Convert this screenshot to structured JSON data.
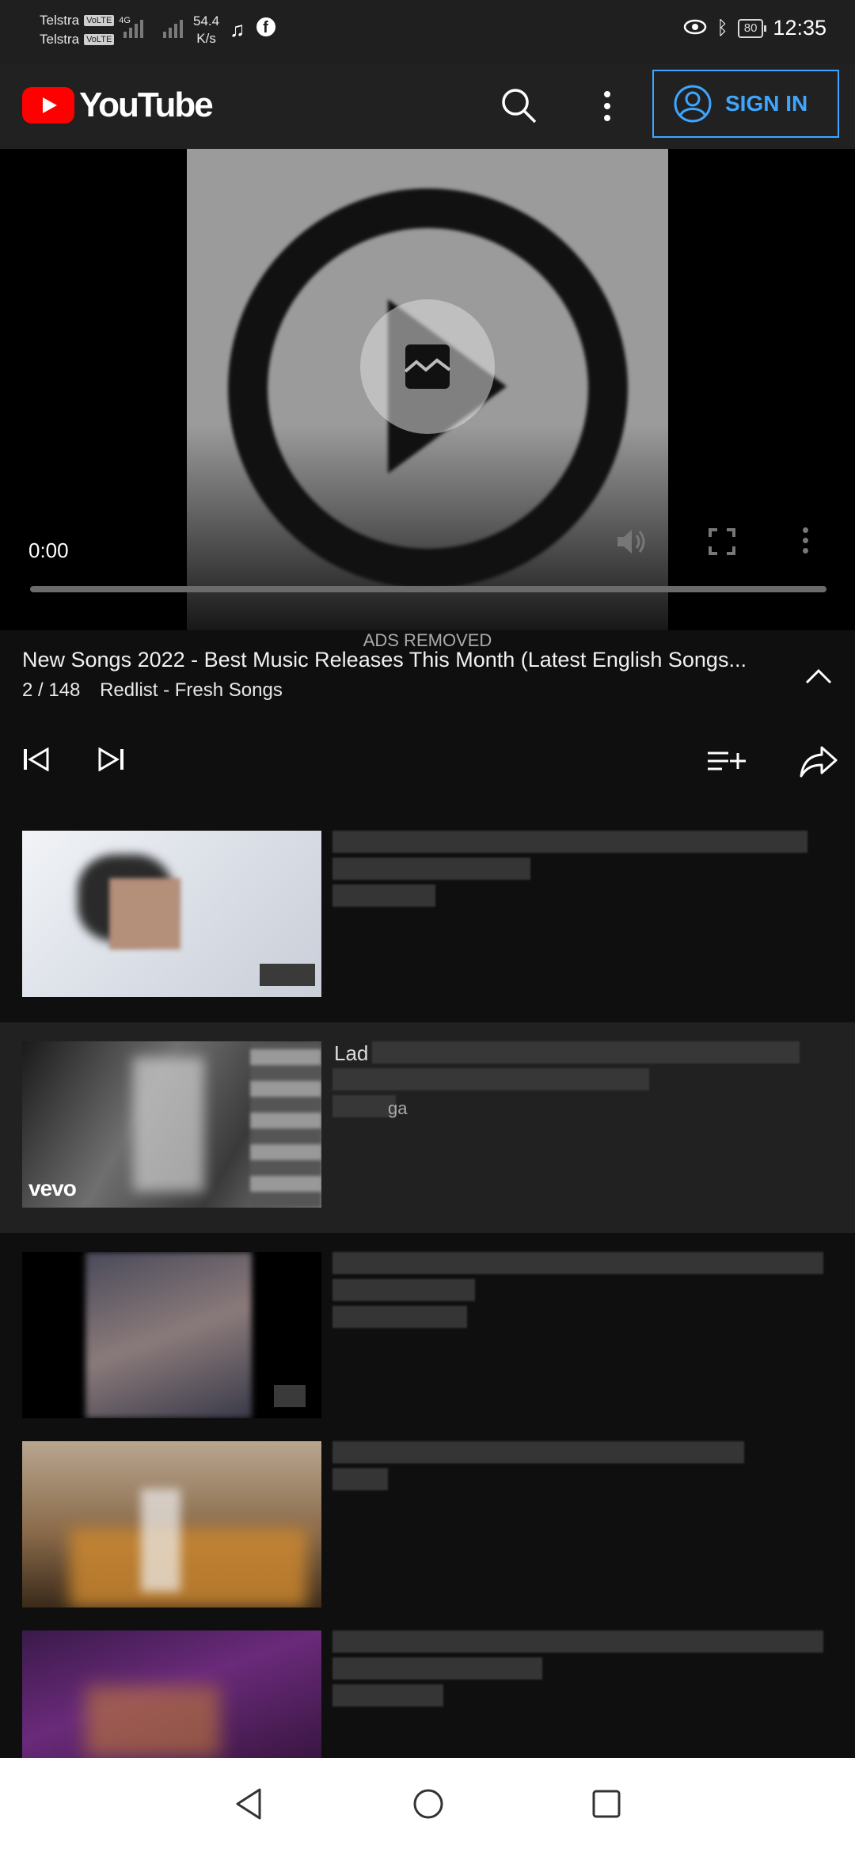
{
  "status_bar": {
    "carrier_1": "Telstra",
    "carrier_2": "Telstra",
    "volte": "VoLTE",
    "network": "4G",
    "speed_value": "54.4",
    "speed_unit": "K/s",
    "battery": "80",
    "time": "12:35"
  },
  "app_bar": {
    "logo_text": "YouTube",
    "sign_in_label": "SIGN IN"
  },
  "player": {
    "current_time": "0:00",
    "overlay_note": "ADS REMOVED"
  },
  "playlist": {
    "title": "New Songs 2022 - Best Music Releases This Month (Latest English Songs...",
    "position": "2 / 148",
    "name": "Redlist - Fresh Songs"
  },
  "list": {
    "item_2_title_fragment": "Lad",
    "item_2_channel_fragment": "ga",
    "item_2_badge": "vevo"
  },
  "colors": {
    "accent_blue": "#3ea6ff",
    "brand_red": "#ff0000",
    "background": "#0f0f0f",
    "active_row": "#212121"
  }
}
